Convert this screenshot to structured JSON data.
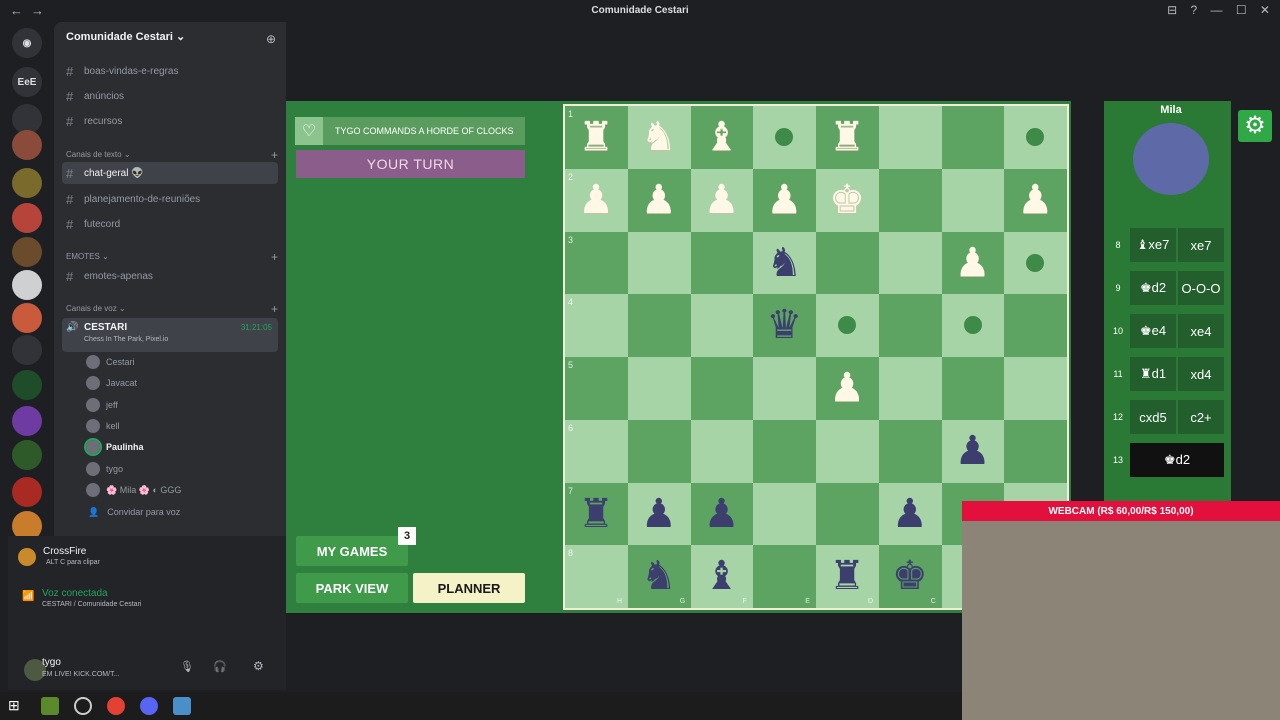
{
  "window": {
    "title": "Comunidade Cestari",
    "controls": "⊟ ? — ☐ ✕"
  },
  "guilds": {
    "initials": "EeE",
    "items": [
      "discord-icon",
      "server",
      "server",
      "server",
      "server",
      "server",
      "server",
      "server",
      "server",
      "server",
      "server",
      "server",
      "server"
    ]
  },
  "server": {
    "name": "Comunidade Cestari ⌄"
  },
  "channels": [
    {
      "name": "boas-vindas-e-regras"
    },
    {
      "name": "anúncios"
    },
    {
      "name": "recursos"
    }
  ],
  "categories": {
    "text": "Canais de texto ⌄",
    "emotes": "EMOTES ⌄",
    "voice": "Canais de voz ⌄"
  },
  "text_channels": [
    {
      "name": "chat-geral 👽",
      "active": true
    },
    {
      "name": "planejamento-de-reuniões"
    },
    {
      "name": "futecord"
    }
  ],
  "emote_channels": [
    {
      "name": "emotes-apenas"
    }
  ],
  "voice": {
    "channel": "CESTARI",
    "timer": "31:21:05",
    "activity": "Chess In The Park, Pixel.io",
    "users": [
      "Cestari",
      "Javacat",
      "jeff",
      "kell",
      "Paulinha",
      "tygo",
      "🌸 Mila 🌸 ◐ GGG"
    ],
    "invite": "Convidar para voz"
  },
  "usercard": {
    "game_name": "CrossFire",
    "clip_hint": "ALT  C  para clipar",
    "voice_status": "Voz conectada",
    "voice_location": "CESTARI / Comunidade Cestari",
    "username": "tygo",
    "status": "EM LIVE! KICK.COM/T..."
  },
  "game": {
    "banner": "TYGO COMMANDS A HORDE OF CLOCKS",
    "turn": "YOUR TURN",
    "buttons": {
      "my_games": "MY GAMES",
      "my_games_badge": "3",
      "park_view": "PARK VIEW",
      "planner": "PLANNER"
    },
    "opponent": "Mila",
    "ranks": [
      "1",
      "2",
      "3",
      "4",
      "5",
      "6",
      "7",
      "8"
    ],
    "files": [
      "H",
      "G",
      "F",
      "E",
      "D",
      "C",
      "B",
      "A"
    ],
    "pieces": [
      {
        "r": 0,
        "c": 0,
        "t": "♜",
        "s": "w"
      },
      {
        "r": 0,
        "c": 1,
        "t": "♞",
        "s": "w"
      },
      {
        "r": 0,
        "c": 2,
        "t": "♝",
        "s": "w"
      },
      {
        "r": 0,
        "c": 4,
        "t": "♜",
        "s": "w"
      },
      {
        "r": 1,
        "c": 0,
        "t": "♟",
        "s": "w"
      },
      {
        "r": 1,
        "c": 1,
        "t": "♟",
        "s": "w"
      },
      {
        "r": 1,
        "c": 2,
        "t": "♟",
        "s": "w"
      },
      {
        "r": 1,
        "c": 3,
        "t": "♟",
        "s": "w"
      },
      {
        "r": 1,
        "c": 4,
        "t": "♚",
        "s": "w"
      },
      {
        "r": 1,
        "c": 7,
        "t": "♟",
        "s": "w"
      },
      {
        "r": 2,
        "c": 3,
        "t": "♞",
        "s": "b"
      },
      {
        "r": 2,
        "c": 6,
        "t": "♟",
        "s": "w"
      },
      {
        "r": 3,
        "c": 3,
        "t": "♛",
        "s": "b"
      },
      {
        "r": 4,
        "c": 4,
        "t": "♟",
        "s": "w"
      },
      {
        "r": 5,
        "c": 6,
        "t": "♟",
        "s": "b"
      },
      {
        "r": 6,
        "c": 0,
        "t": "♜",
        "s": "b"
      },
      {
        "r": 6,
        "c": 1,
        "t": "♟",
        "s": "b"
      },
      {
        "r": 6,
        "c": 2,
        "t": "♟",
        "s": "b"
      },
      {
        "r": 6,
        "c": 5,
        "t": "♟",
        "s": "b"
      },
      {
        "r": 7,
        "c": 1,
        "t": "♞",
        "s": "b"
      },
      {
        "r": 7,
        "c": 2,
        "t": "♝",
        "s": "b"
      },
      {
        "r": 7,
        "c": 4,
        "t": "♜",
        "s": "b"
      },
      {
        "r": 7,
        "c": 5,
        "t": "♚",
        "s": "b"
      }
    ],
    "dots": [
      {
        "r": 0,
        "c": 3
      },
      {
        "r": 0,
        "c": 7
      },
      {
        "r": 2,
        "c": 7
      },
      {
        "r": 3,
        "c": 4
      },
      {
        "r": 3,
        "c": 6
      }
    ],
    "moves": [
      {
        "n": "8",
        "a": "♝xe7",
        "b": "xe7"
      },
      {
        "n": "9",
        "a": "♚d2",
        "b": "O-O-O"
      },
      {
        "n": "10",
        "a": "♚e4",
        "b": "xe4"
      },
      {
        "n": "11",
        "a": "♜d1",
        "b": "xd4"
      },
      {
        "n": "12",
        "a": "cxd5",
        "b": "c2+"
      },
      {
        "n": "13",
        "a": "♚d2",
        "b": ""
      }
    ]
  },
  "webcam": {
    "label": "WEBCAM (R$ 60,00/R$ 150,00)"
  }
}
